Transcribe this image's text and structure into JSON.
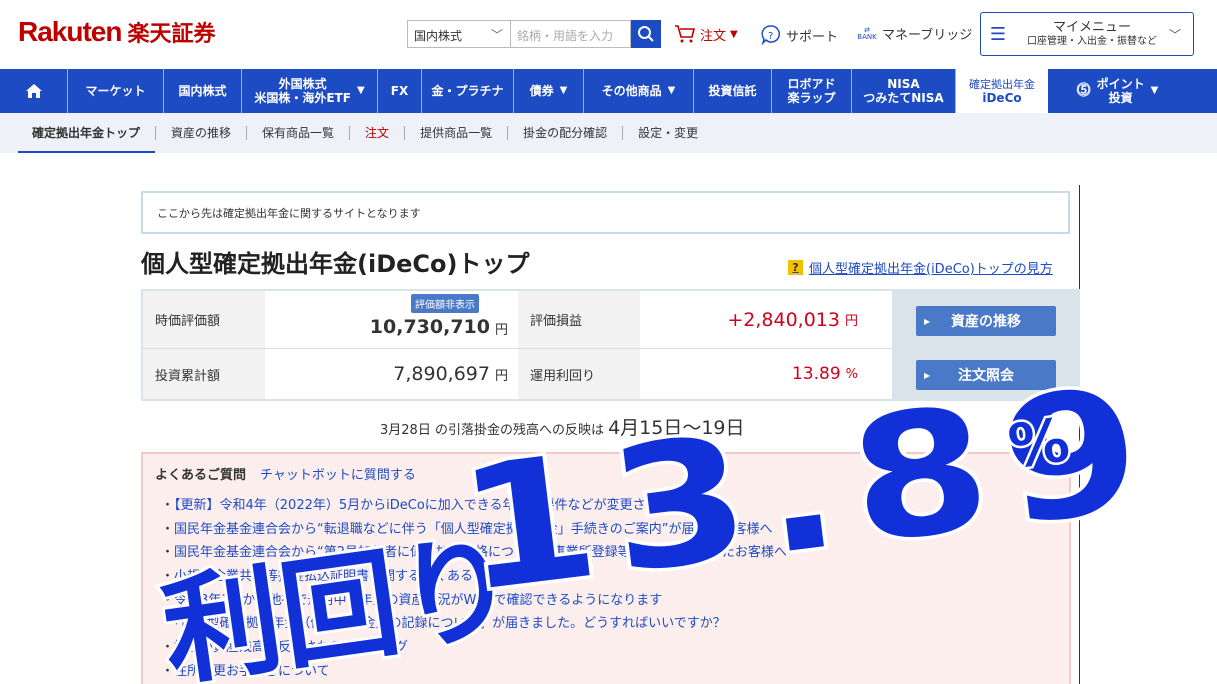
{
  "header": {
    "logo_en": "Rakuten",
    "logo_jp": "楽天証券",
    "search_select": "国内株式",
    "search_placeholder": "銘柄・用語を入力",
    "order": "注文",
    "support": "サポート",
    "bridge_badge": "BANK",
    "bridge": "マネーブリッジ",
    "mymenu_title": "マイメニュー",
    "mymenu_sub": "口座管理・入出金・振替など"
  },
  "nav": {
    "items": [
      {
        "label": "マーケット"
      },
      {
        "label": "国内株式"
      },
      {
        "label1": "外国株式",
        "label2": "米国株・海外ETF"
      },
      {
        "label": "FX"
      },
      {
        "label": "金・プラチナ"
      },
      {
        "label": "債券"
      },
      {
        "label": "その他商品"
      },
      {
        "label": "投資信託"
      },
      {
        "label1": "ロボアド",
        "label2": "楽ラップ"
      },
      {
        "label1": "NISA",
        "label2": "つみたてNISA"
      },
      {
        "label1": "確定拠出年金",
        "label2": "iDeCo"
      },
      {
        "label1": "ポイント",
        "label2": "投資"
      }
    ]
  },
  "subnav": {
    "items": [
      "確定拠出年金トップ",
      "資産の推移",
      "保有商品一覧",
      "注文",
      "提供商品一覧",
      "掛金の配分確認",
      "設定・変更"
    ]
  },
  "notice": "ここから先は確定拠出年金に関するサイトとなります",
  "page_title": "個人型確定拠出年金(iDeCo)トップ",
  "help": {
    "mark": "?",
    "link": "個人型確定拠出年金(iDeCo)トップの見方"
  },
  "summary": {
    "market_value_label": "時価評価額",
    "market_value_badge": "評価額非表示",
    "market_value": "10,730,710",
    "gain_label": "評価損益",
    "gain": "+2,840,013",
    "invested_label": "投資累計額",
    "invested": "7,890,697",
    "yield_label": "運用利回り",
    "yield": "13.89",
    "yield_unit": "%",
    "yen": "円",
    "btn_history": "資産の推移",
    "btn_order": "注文照会"
  },
  "reflect": {
    "pre": "3月28日 の引落掛金の残高への反映は ",
    "date": "4月15日〜19日"
  },
  "faq": {
    "title": "よくあるご質問",
    "chatbot": "チャットボットに質問する",
    "items": [
      "【更新】令和4年（2022年）5月からiDeCoに加入できる年齢の要件などが変更されます",
      "国民年金基金連合会から“転退職などに伴う「個人型確定拠出年金」手続きのご案内”が届いたお客様へ",
      "国民年金基金連合会から“第2号加入者に係る加入資格について（事業所登録等届出書）”が届いたお客様へ",
      "小規模企業共済等掛金払込証明書に関するよくあるお問い合わせ",
      "令和3年1月から他社で運用中の年金の資産状況がWEBで確認できるようになります",
      "「個人型確定拠出年金（個人型年金）の記録について」が届きました。どうすればいいですか？",
      "掛金が資産残高に反映されるタイミング",
      "住所変更お手続きについて"
    ]
  },
  "overlay": {
    "label": "利回り",
    "number": "13.89",
    "unit": "%",
    "color": "#1230d8"
  },
  "colors": {
    "brand": "#bf0000",
    "nav": "#1d4bc4",
    "gain": "#d0021b",
    "faq_bg": "#fdeeee"
  }
}
